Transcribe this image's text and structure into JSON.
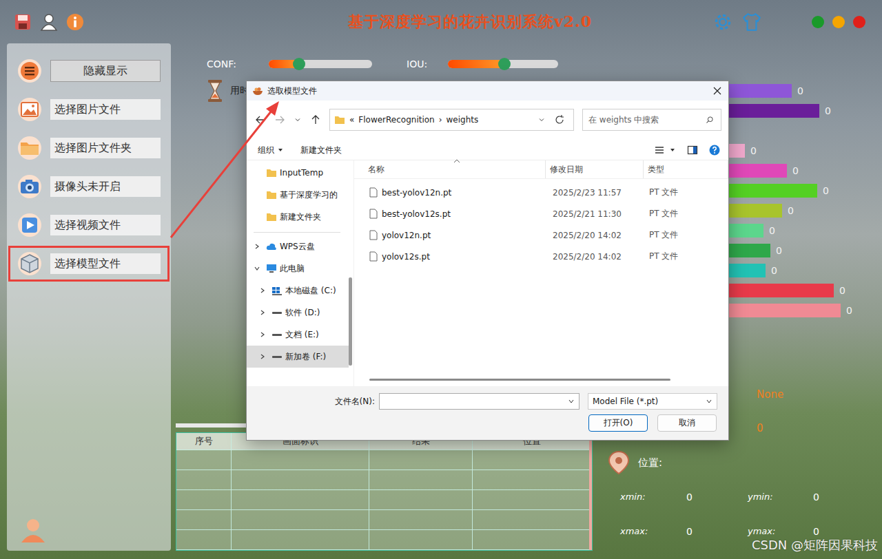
{
  "window": {
    "title": "基于深度学习的花卉识别系统v2.0"
  },
  "window_controls": [
    {
      "color": "#1a9a2a"
    },
    {
      "color": "#f5a500"
    },
    {
      "color": "#e0201a"
    }
  ],
  "sidebar": {
    "items": [
      {
        "label": "隐藏显示",
        "selected": false,
        "kind": "toggle"
      },
      {
        "label": "选择图片文件",
        "selected": false,
        "kind": "image"
      },
      {
        "label": "选择图片文件夹",
        "selected": false,
        "kind": "folder"
      },
      {
        "label": "摄像头未开启",
        "selected": false,
        "kind": "camera"
      },
      {
        "label": "选择视频文件",
        "selected": false,
        "kind": "video"
      },
      {
        "label": "选择模型文件",
        "selected": true,
        "kind": "model"
      }
    ]
  },
  "sliders": [
    {
      "label": "CONF:",
      "level": 0.29
    },
    {
      "label": "IOU:",
      "level": 0.51
    }
  ],
  "timer": {
    "label": "用时"
  },
  "chart": {
    "bars": [
      {
        "value": "0",
        "level": 0.79,
        "color": "#8e56d8"
      },
      {
        "value": "0",
        "level": 0.91,
        "color": "#6a1e9a"
      },
      {
        "value": "0",
        "level": 0.59,
        "color": "#f0a8cc"
      },
      {
        "value": "0",
        "level": 0.77,
        "color": "#e048b8"
      },
      {
        "value": "0",
        "level": 0.9,
        "color": "#54d024"
      },
      {
        "value": "0",
        "level": 0.75,
        "color": "#a8c42c"
      },
      {
        "value": "0",
        "level": 0.67,
        "color": "#5cd68c"
      },
      {
        "value": "0",
        "level": 0.7,
        "color": "#2ea84a"
      },
      {
        "value": "0",
        "level": 0.68,
        "color": "#22c2b4"
      },
      {
        "value": "0",
        "level": 0.97,
        "color": "#e83a4a"
      },
      {
        "value": "0",
        "level": 1.0,
        "color": "#f08a94"
      }
    ]
  },
  "table": {
    "columns": [
      "序号",
      "画面标识",
      "结果",
      "位置"
    ],
    "rows": []
  },
  "result": {
    "class": "None",
    "confidence": "0",
    "position_label": "位置:",
    "coords": [
      {
        "label": "xmin:",
        "value": "0"
      },
      {
        "label": "ymin:",
        "value": "0"
      },
      {
        "label": "xmax:",
        "value": "0"
      },
      {
        "label": "ymax:",
        "value": "0"
      }
    ]
  },
  "dialog": {
    "title": "选取模型文件",
    "path": {
      "prefix": "«",
      "separator": "›",
      "parts": [
        "FlowerRecognition",
        "weights"
      ]
    },
    "search_placeholder": "在 weights 中搜索",
    "toolbar": [
      {
        "label": "组织",
        "dropdown": true
      },
      {
        "label": "新建文件夹",
        "dropdown": false
      }
    ],
    "quick_access": [
      {
        "label": "InputTemp",
        "kind": "folder",
        "depth": 0,
        "expandable": false,
        "expanded": false,
        "selected": false
      },
      {
        "label": "基于深度学习的",
        "kind": "folder",
        "depth": 0,
        "expandable": false,
        "expanded": false,
        "selected": false
      },
      {
        "label": "新建文件夹",
        "kind": "folder",
        "depth": 0,
        "expandable": false,
        "expanded": false,
        "selected": false
      }
    ],
    "locations": [
      {
        "label": "WPS云盘",
        "kind": "cloud",
        "depth": 0,
        "expandable": true,
        "expanded": false,
        "selected": false
      },
      {
        "label": "此电脑",
        "kind": "pc",
        "depth": 0,
        "expandable": true,
        "expanded": true,
        "selected": false
      },
      {
        "label": "本地磁盘 (C:)",
        "kind": "system-drive",
        "depth": 1,
        "expandable": true,
        "expanded": false,
        "selected": false
      },
      {
        "label": "软件 (D:)",
        "kind": "drive",
        "depth": 1,
        "expandable": true,
        "expanded": false,
        "selected": false
      },
      {
        "label": "文档 (E:)",
        "kind": "drive",
        "depth": 1,
        "expandable": true,
        "expanded": false,
        "selected": false
      },
      {
        "label": "新加卷 (F:)",
        "kind": "drive",
        "depth": 1,
        "expandable": true,
        "expanded": false,
        "selected": true
      }
    ],
    "columns": [
      "名称",
      "修改日期",
      "类型"
    ],
    "files": [
      {
        "name": "best-yolov12n.pt",
        "date": "2025/2/23 11:57",
        "type": "PT 文件",
        "selected": false
      },
      {
        "name": "best-yolov12s.pt",
        "date": "2025/2/21 11:30",
        "type": "PT 文件",
        "selected": false
      },
      {
        "name": "yolov12n.pt",
        "date": "2025/2/20 14:02",
        "type": "PT 文件",
        "selected": false
      },
      {
        "name": "yolov12s.pt",
        "date": "2025/2/20 14:02",
        "type": "PT 文件",
        "selected": false
      }
    ],
    "filename": {
      "label": "文件名(N):",
      "value": ""
    },
    "filter": "Model File (*.pt)",
    "buttons": [
      {
        "label": "打开(O)",
        "primary": true
      },
      {
        "label": "取消",
        "primary": false
      }
    ]
  },
  "watermark": "CSDN @矩阵因果科技"
}
